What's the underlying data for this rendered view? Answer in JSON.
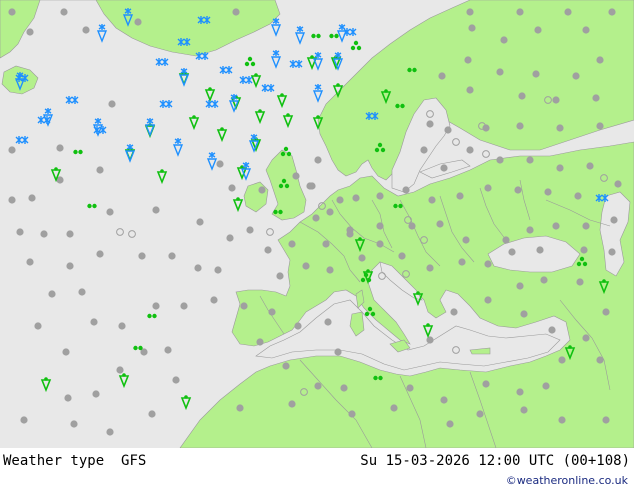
{
  "header": {
    "parameter": "Weather type",
    "model": "GFS",
    "valid_time": "Su 15-03-2026 12:00 UTC (00+108)"
  },
  "credit": "©weatheronline.co.uk",
  "colors": {
    "sea": "#e8e8e8",
    "land": "#b4f08c",
    "border": "#9a9a9a",
    "rain": "#10c010",
    "snow": "#1e90ff",
    "dry_dot": "#a0a0a0"
  },
  "legend_symbols": {
    "rain-icon": "drizzle / rain showers",
    "snow-icon": "snow",
    "dot-icon": "dry / no weather"
  }
}
